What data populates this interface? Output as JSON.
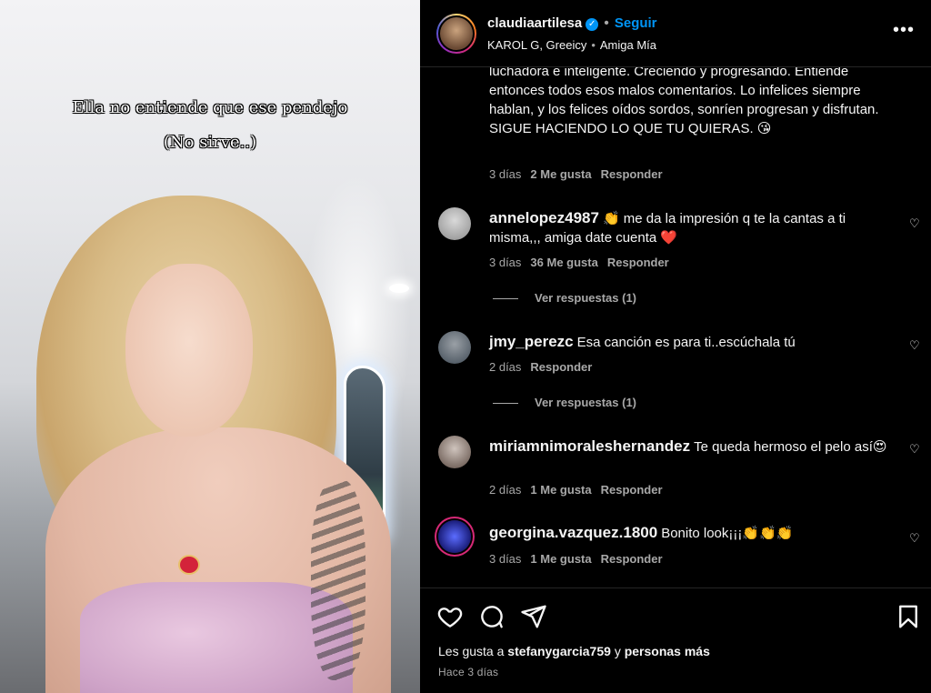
{
  "media": {
    "caption_line1": "Ella no entiende que ese pendejo",
    "caption_line2": "(No sirve..)"
  },
  "header": {
    "username": "claudiaartilesa",
    "verified_mark": "✓",
    "dot": "•",
    "follow_label": "Seguir",
    "song_artist": "KAROL G, Greeicy",
    "song_title": "Amiga Mía",
    "more_icon": "•••"
  },
  "comments": [
    {
      "text": "luchadora e inteligente. Creciendo y progresando. Entiende entonces todos esos malos comentarios. Lo infelices siempre hablan, y los felices oídos sordos, sonríen progresan y disfrutan. SIGUE HACIENDO LO QUE TU QUIERAS. 😘",
      "time": "3 días",
      "likes": "2 Me gusta",
      "reply": "Responder"
    },
    {
      "user": "annelopez4987",
      "text": "👏 me da la impresión q te la cantas a ti misma,,, amiga date cuenta ❤️",
      "time": "3 días",
      "likes": "36 Me gusta",
      "reply": "Responder",
      "view_replies": "Ver respuestas (1)"
    },
    {
      "user": "jmy_perezc",
      "text": "Esa canción es para ti..escúchala tú",
      "time": "2 días",
      "reply": "Responder",
      "view_replies": "Ver respuestas (1)"
    },
    {
      "user": "miriamnimoraleshernandez",
      "text": "Te queda hermoso el pelo así😍",
      "time": "2 días",
      "likes": "1 Me gusta",
      "reply": "Responder"
    },
    {
      "user": "georgina.vazquez.1800",
      "text": "Bonito look¡¡¡👏👏👏",
      "time": "3 días",
      "likes": "1 Me gusta",
      "reply": "Responder"
    }
  ],
  "icons": {
    "heart_small": "♡",
    "like": "heart-icon",
    "comment": "comment-icon",
    "share": "share-icon",
    "save": "bookmark-icon"
  },
  "footer": {
    "likes_prefix": "Les gusta a",
    "likes_user": "stefanygarcia759",
    "likes_and": "y",
    "likes_suffix": "personas más",
    "posted": "Hace 3 días"
  },
  "colors": {
    "accent": "#0095f6",
    "background": "#000000",
    "muted": "#a8a8a8"
  }
}
